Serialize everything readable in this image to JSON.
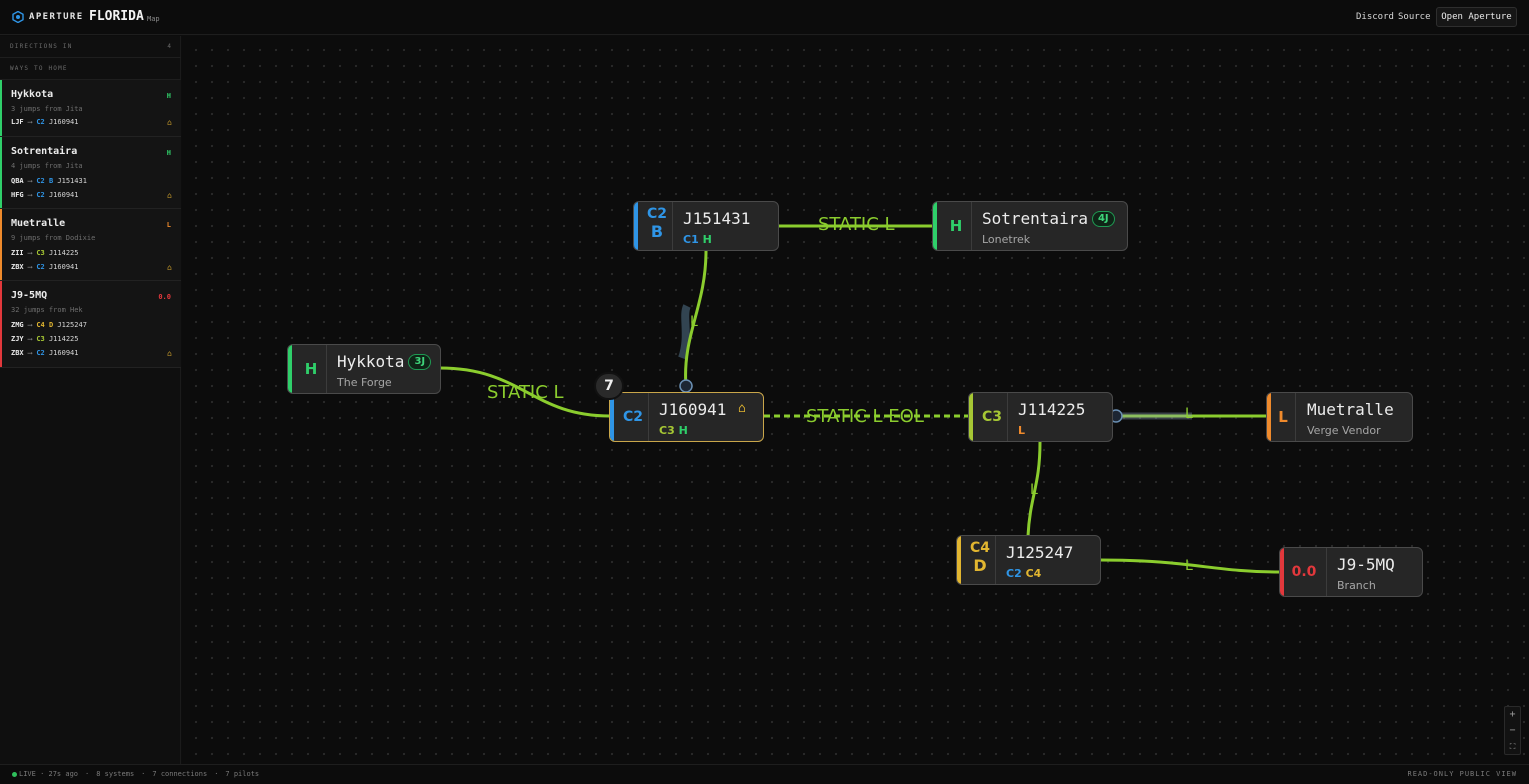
{
  "header": {
    "brand": "APERTURE",
    "map_name": "FLORIDA",
    "map_sub": "Map",
    "links": [
      "Discord",
      "Source"
    ],
    "open_button": "Open Aperture"
  },
  "sidebar": {
    "directions_label": "DIRECTIONS IN",
    "directions_count": "4",
    "ways_label": "WAYS TO HOME",
    "routes": [
      {
        "name": "Hykkota",
        "tag": "H",
        "sub": "3 jumps from Jita",
        "lines": [
          {
            "code": "LJF",
            "cls": "C2",
            "cls2": "",
            "sys": "J160941"
          }
        ]
      },
      {
        "name": "Sotrentaira",
        "tag": "H",
        "sub": "4 jumps from Jita",
        "lines": [
          {
            "code": "QBA",
            "cls": "C2",
            "cls2": "B",
            "sys": "J151431"
          },
          {
            "code": "HFG",
            "cls": "C2",
            "cls2": "",
            "sys": "J160941"
          }
        ]
      },
      {
        "name": "Muetralle",
        "tag": "L",
        "sub": "9 jumps from Dodixie",
        "lines": [
          {
            "code": "ZII",
            "cls": "C3",
            "cls2": "",
            "sys": "J114225"
          },
          {
            "code": "ZBX",
            "cls": "C2",
            "cls2": "",
            "sys": "J160941"
          }
        ]
      },
      {
        "name": "J9-5MQ",
        "tag": "0.0",
        "sub": "32 jumps from Hek",
        "lines": [
          {
            "code": "ZMG",
            "cls": "C4",
            "cls2": "D",
            "sys": "J125247"
          },
          {
            "code": "ZJY",
            "cls": "C3",
            "cls2": "",
            "sys": "J114225"
          },
          {
            "code": "ZBX",
            "cls": "C2",
            "cls2": "",
            "sys": "J160941"
          }
        ]
      }
    ]
  },
  "nodes": {
    "j151431": {
      "cls": "C2",
      "cls2": "B",
      "title": "J151431",
      "statics": [
        "C1",
        "H"
      ]
    },
    "sotrentaira": {
      "cls": "H",
      "title": "Sotrentaira",
      "badge": "4J",
      "sub": "Lonetrek"
    },
    "hykkota": {
      "cls": "H",
      "title": "Hykkota",
      "badge": "3J",
      "sub": "The Forge"
    },
    "j160941": {
      "cls": "C2",
      "title": "J160941",
      "statics": [
        "C3",
        "H"
      ],
      "pilots": "7"
    },
    "j114225": {
      "cls": "C3",
      "title": "J114225",
      "statics": [
        "L"
      ]
    },
    "muetralle": {
      "cls": "L",
      "title": "Muetralle",
      "sub": "Verge Vendor"
    },
    "j125247": {
      "cls": "C4",
      "cls2": "D",
      "title": "J125247",
      "statics": [
        "C2",
        "C4"
      ]
    },
    "j95mq": {
      "cls": "0.0",
      "title": "J9-5MQ",
      "sub": "Branch"
    }
  },
  "edge_labels": {
    "a": "STATIC L",
    "b": "STATIC L",
    "c": "STATIC L EOL",
    "d": "L",
    "e": "L",
    "f": "L",
    "g": "L"
  },
  "footer": {
    "live": "LIVE · 27s ago",
    "systems": "8 systems",
    "connections": "7 connections",
    "pilots": "7 pilots",
    "readonly": "READ-ONLY PUBLIC VIEW"
  },
  "colors": {
    "accent": "#8bcd2e",
    "class_c2": "#2f95e6",
    "class_c3": "#a6c734",
    "class_c4": "#e2b630",
    "highsec": "#2fcf6a",
    "lowsec": "#ef8a2c",
    "nullsec": "#e2383c"
  }
}
